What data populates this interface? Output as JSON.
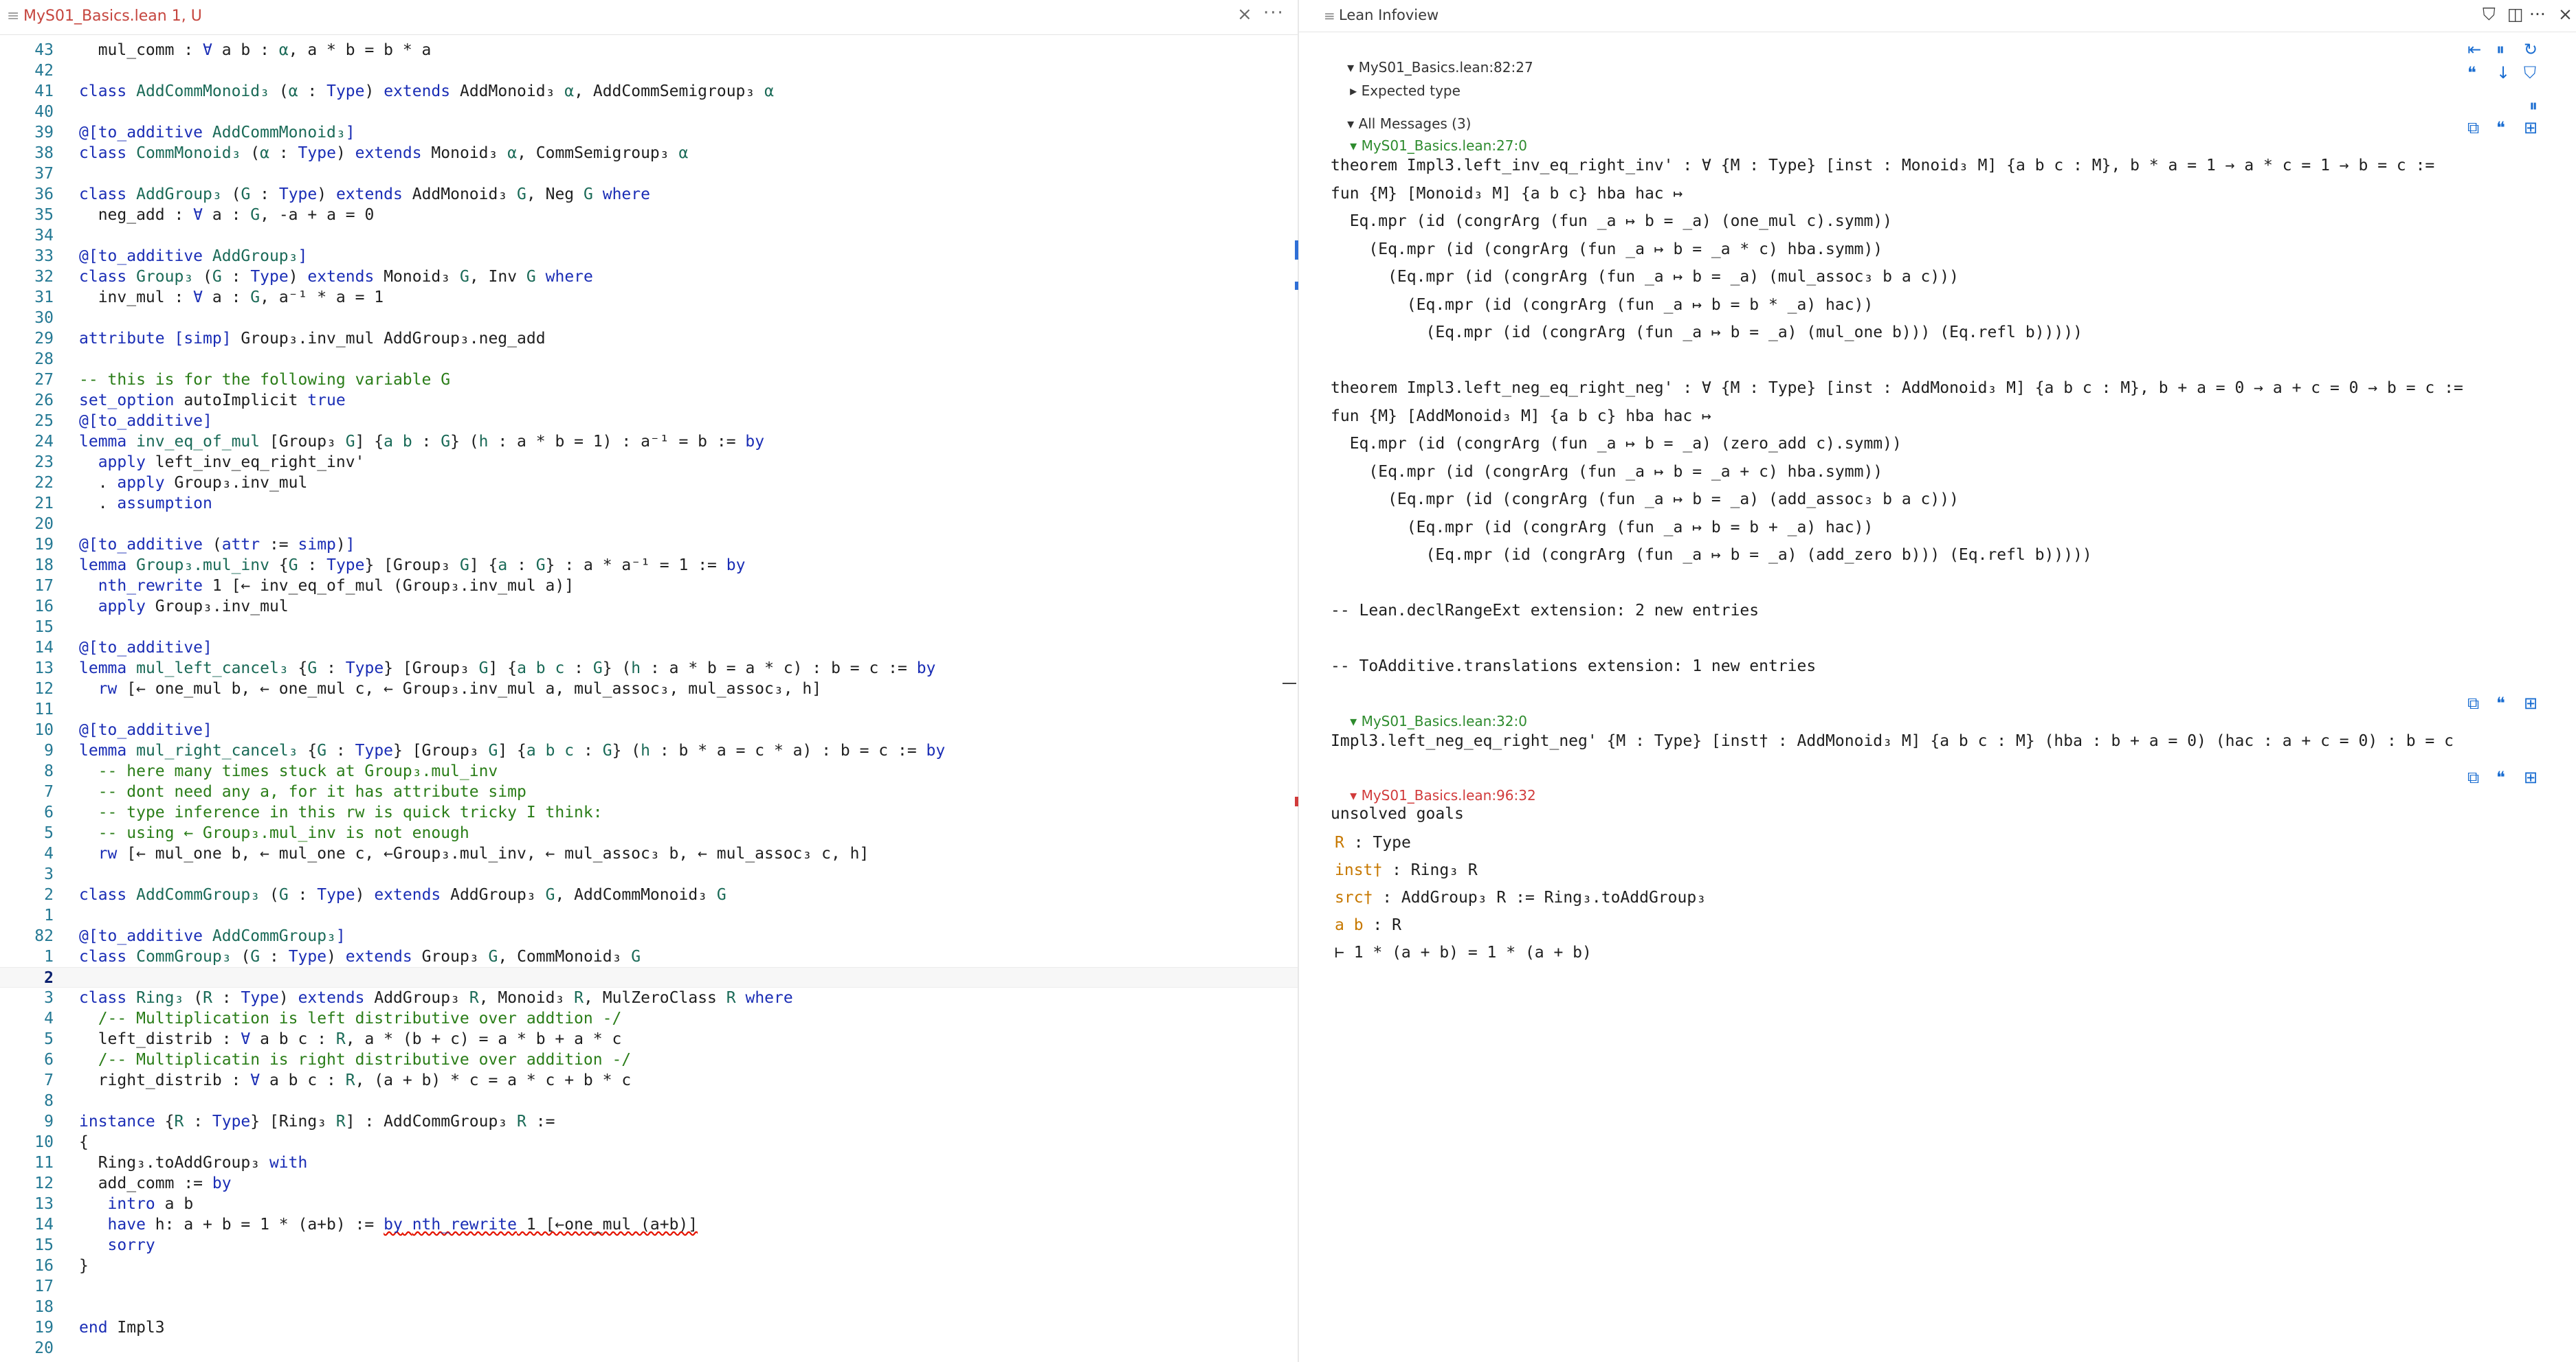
{
  "editor": {
    "tab_menu_icon": "hamburger-icon",
    "tab_title": "MyS01_Basics.lean 1, U",
    "close_glyph": "×",
    "more_glyph": "···",
    "lines": [
      {
        "n": "43",
        "html": "  mul_comm : <span class=\"k\">∀</span> a b : <span class=\"t\">α</span>, a * b = b * a"
      },
      {
        "n": "42",
        "html": ""
      },
      {
        "n": "41",
        "html": "<span class=\"k\">class</span> <span class=\"t\">AddCommMonoid₃</span> (<span class=\"t\">α</span> : <span class=\"k\">Type</span>) <span class=\"k\">extends</span> AddMonoid₃ <span class=\"t\">α</span>, AddCommSemigroup₃ <span class=\"t\">α</span>"
      },
      {
        "n": "40",
        "html": ""
      },
      {
        "n": "39",
        "html": "<span class=\"k\">@[to_additive</span> <span class=\"t\">AddCommMonoid₃</span><span class=\"k\">]</span>"
      },
      {
        "n": "38",
        "html": "<span class=\"k\">class</span> <span class=\"t\">CommMonoid₃</span> (<span class=\"t\">α</span> : <span class=\"k\">Type</span>) <span class=\"k\">extends</span> Monoid₃ <span class=\"t\">α</span>, CommSemigroup₃ <span class=\"t\">α</span>"
      },
      {
        "n": "37",
        "html": ""
      },
      {
        "n": "36",
        "html": "<span class=\"k\">class</span> <span class=\"t\">AddGroup₃</span> (<span class=\"t\">G</span> : <span class=\"k\">Type</span>) <span class=\"k\">extends</span> AddMonoid₃ <span class=\"t\">G</span>, Neg <span class=\"t\">G</span> <span class=\"k\">where</span>"
      },
      {
        "n": "35",
        "html": "  neg_add : <span class=\"k\">∀</span> a : <span class=\"t\">G</span>, -a + a = 0"
      },
      {
        "n": "34",
        "html": ""
      },
      {
        "n": "33",
        "html": "<span class=\"k\">@[to_additive</span> <span class=\"t\">AddGroup₃</span><span class=\"k\">]</span>"
      },
      {
        "n": "32",
        "html": "<span class=\"k\">class</span> <span class=\"t\">Group₃</span> (<span class=\"t\">G</span> : <span class=\"k\">Type</span>) <span class=\"k\">extends</span> Monoid₃ <span class=\"t\">G</span>, Inv <span class=\"t\">G</span> <span class=\"k\">where</span>"
      },
      {
        "n": "31",
        "html": "  inv_mul : <span class=\"k\">∀</span> a : <span class=\"t\">G</span>, a⁻¹ * a = 1"
      },
      {
        "n": "30",
        "html": ""
      },
      {
        "n": "29",
        "html": "<span class=\"k\">attribute</span> <span class=\"k\">[simp]</span> Group₃.inv_mul AddGroup₃.neg_add"
      },
      {
        "n": "28",
        "html": ""
      },
      {
        "n": "27",
        "html": "<span class=\"c\">-- this is for the following variable G</span>"
      },
      {
        "n": "26",
        "html": "<span class=\"k\">set_option</span> autoImplicit <span class=\"k\">true</span>"
      },
      {
        "n": "25",
        "html": "<span class=\"k\">@[to_additive]</span>"
      },
      {
        "n": "24",
        "html": "<span class=\"k\">lemma</span> <span class=\"t\">inv_eq_of_mul</span> [Group₃ <span class=\"t\">G</span>] {<span class=\"t\">a b</span> : <span class=\"t\">G</span>} (<span class=\"t\">h</span> : a * b = 1) : a⁻¹ = b := <span class=\"k\">by</span>"
      },
      {
        "n": "23",
        "html": "  <span class=\"k\">apply</span> left_inv_eq_right_inv'"
      },
      {
        "n": "22",
        "html": "  . <span class=\"k\">apply</span> Group₃.inv_mul"
      },
      {
        "n": "21",
        "html": "  . <span class=\"k\">assumption</span>"
      },
      {
        "n": "20",
        "html": ""
      },
      {
        "n": "19",
        "html": "<span class=\"k\">@[to_additive</span> (<span class=\"k\">attr</span> := <span class=\"k\">simp</span>)<span class=\"k\">]</span>"
      },
      {
        "n": "18",
        "html": "<span class=\"k\">lemma</span> <span class=\"t\">Group₃.mul_inv</span> {<span class=\"t\">G</span> : <span class=\"k\">Type</span>} [Group₃ <span class=\"t\">G</span>] {<span class=\"t\">a</span> : <span class=\"t\">G</span>} : a * a⁻¹ = 1 := <span class=\"k\">by</span>"
      },
      {
        "n": "17",
        "html": "  <span class=\"k\">nth_rewrite</span> 1 [← inv_eq_of_mul (Group₃.inv_mul a)]"
      },
      {
        "n": "16",
        "html": "  <span class=\"k\">apply</span> Group₃.inv_mul"
      },
      {
        "n": "15",
        "html": ""
      },
      {
        "n": "14",
        "html": "<span class=\"k\">@[to_additive]</span>"
      },
      {
        "n": "13",
        "html": "<span class=\"k\">lemma</span> <span class=\"t\">mul_left_cancel₃</span> {<span class=\"t\">G</span> : <span class=\"k\">Type</span>} [Group₃ <span class=\"t\">G</span>] {<span class=\"t\">a b c</span> : <span class=\"t\">G</span>} (<span class=\"t\">h</span> : a * b = a * c) : b = c := <span class=\"k\">by</span>"
      },
      {
        "n": "12",
        "html": "  <span class=\"k\">rw</span> [← one_mul b, ← one_mul c, ← Group₃.inv_mul a, mul_assoc₃, mul_assoc₃, h]"
      },
      {
        "n": "11",
        "html": ""
      },
      {
        "n": "10",
        "html": "<span class=\"k\">@[to_additive]</span>"
      },
      {
        "n": "9",
        "html": "<span class=\"k\">lemma</span> <span class=\"t\">mul_right_cancel₃</span> {<span class=\"t\">G</span> : <span class=\"k\">Type</span>} [Group₃ <span class=\"t\">G</span>] {<span class=\"t\">a b c</span> : <span class=\"t\">G</span>} (<span class=\"t\">h</span> : b * a = c * a) : b = c := <span class=\"k\">by</span>"
      },
      {
        "n": "8",
        "html": "  <span class=\"c\">-- here many times stuck at Group₃.mul_inv</span>"
      },
      {
        "n": "7",
        "html": "  <span class=\"c\">-- dont need any a, for it has attribute simp</span>"
      },
      {
        "n": "6",
        "html": "  <span class=\"c\">-- type inference in this rw is quick tricky I think:</span>"
      },
      {
        "n": "5",
        "html": "  <span class=\"c\">-- using ← Group₃.mul_inv is not enough</span>"
      },
      {
        "n": "4",
        "html": "  <span class=\"k\">rw</span> [← mul_one b, ← mul_one c, ←Group₃.mul_inv, ← mul_assoc₃ b, ← mul_assoc₃ c, h]"
      },
      {
        "n": "3",
        "html": ""
      },
      {
        "n": "2",
        "html": "<span class=\"k\">class</span> <span class=\"t\">AddCommGroup₃</span> (<span class=\"t\">G</span> : <span class=\"k\">Type</span>) <span class=\"k\">extends</span> AddGroup₃ <span class=\"t\">G</span>, AddCommMonoid₃ <span class=\"t\">G</span>"
      },
      {
        "n": "1",
        "html": ""
      },
      {
        "n": "82",
        "html": "<span class=\"k\">@[to_additive</span> <span class=\"t\">AddCommGroup₃</span><span class=\"k\">]</span>"
      },
      {
        "n": "1",
        "html": "<span class=\"k\">class</span> <span class=\"t\">CommGroup₃</span> (<span class=\"t\">G</span> : <span class=\"k\">Type</span>) <span class=\"k\">extends</span> Group₃ <span class=\"t\">G</span>, CommMonoid₃ <span class=\"t\">G</span>"
      },
      {
        "n": "2",
        "html": ""
      },
      {
        "n": "3",
        "html": "<span class=\"k\">class</span> <span class=\"t\">Ring₃</span> (<span class=\"t\">R</span> : <span class=\"k\">Type</span>) <span class=\"k\">extends</span> AddGroup₃ <span class=\"t\">R</span>, Monoid₃ <span class=\"t\">R</span>, MulZeroClass <span class=\"t\">R</span> <span class=\"k\">where</span>"
      },
      {
        "n": "4",
        "html": "  <span class=\"c\">/-- Multiplication is left distributive over addtion -/</span>"
      },
      {
        "n": "5",
        "html": "  left_distrib : <span class=\"k\">∀</span> a b c : <span class=\"t\">R</span>, a * (b + c) = a * b + a * c"
      },
      {
        "n": "6",
        "html": "  <span class=\"c\">/-- Multiplicatin is right distributive over addition -/</span>"
      },
      {
        "n": "7",
        "html": "  right_distrib : <span class=\"k\">∀</span> a b c : <span class=\"t\">R</span>, (a + b) * c = a * c + b * c"
      },
      {
        "n": "8",
        "html": ""
      },
      {
        "n": "9",
        "html": "<span class=\"k\">instance</span> {<span class=\"t\">R</span> : <span class=\"k\">Type</span>} [Ring₃ <span class=\"t\">R</span>] : AddCommGroup₃ <span class=\"t\">R</span> :="
      },
      {
        "n": "10",
        "html": "{"
      },
      {
        "n": "11",
        "html": "  Ring₃.toAddGroup₃ <span class=\"k\">with</span>"
      },
      {
        "n": "12",
        "html": "  add_comm := <span class=\"k\">by</span>"
      },
      {
        "n": "13",
        "html": "   <span class=\"k\">intro</span> a b"
      },
      {
        "n": "14",
        "html": "   <span class=\"k\">have</span> h: a + b = 1 * (a+b) := <span class=\"err\"><span class=\"k\">by</span> <span class=\"k\">nth_rewrite</span> 1 [←one_mul (a+b)]</span>"
      },
      {
        "n": "15",
        "html": "   <span class=\"k\">sorry</span>"
      },
      {
        "n": "16",
        "html": "}"
      },
      {
        "n": "17",
        "html": ""
      },
      {
        "n": "18",
        "html": ""
      },
      {
        "n": "19",
        "html": "<span class=\"k\">end</span> Impl3"
      },
      {
        "n": "20",
        "html": ""
      }
    ]
  },
  "infoview": {
    "menu_icon": "hamburger-icon",
    "title": "Lean Infoview",
    "header_icons": [
      "filter-icon",
      "split-icon",
      "more-icon",
      "close-icon"
    ],
    "header_glyphs": [
      "⛉",
      "◫",
      "···",
      "×"
    ],
    "cursor_location": "MyS01_Basics.lean:82:27",
    "expected_type_label": "Expected type",
    "all_messages_label": "All Messages (3)",
    "toolbar_glyphs": [
      "⇤",
      "⏸",
      "↻",
      "❝",
      "↓",
      "⛉"
    ],
    "msg1": {
      "location": "MyS01_Basics.lean:27:0",
      "lines": [
        "theorem Impl3.left_inv_eq_right_inv' : ∀ {M : Type} [inst : Monoid₃ M] {a b c : M}, b * a = 1 → a * c = 1 → b = c :=",
        "fun {M} [Monoid₃ M] {a b c} hba hac ↦",
        "  Eq.mpr (id (congrArg (fun _a ↦ b = _a) (one_mul c).symm))",
        "    (Eq.mpr (id (congrArg (fun _a ↦ b = _a * c) hba.symm))",
        "      (Eq.mpr (id (congrArg (fun _a ↦ b = _a) (mul_assoc₃ b a c)))",
        "        (Eq.mpr (id (congrArg (fun _a ↦ b = b * _a) hac))",
        "          (Eq.mpr (id (congrArg (fun _a ↦ b = _a) (mul_one b))) (Eq.refl b)))))",
        "",
        "theorem Impl3.left_neg_eq_right_neg' : ∀ {M : Type} [inst : AddMonoid₃ M] {a b c : M}, b + a = 0 → a + c = 0 → b = c :=",
        "fun {M} [AddMonoid₃ M] {a b c} hba hac ↦",
        "  Eq.mpr (id (congrArg (fun _a ↦ b = _a) (zero_add c).symm))",
        "    (Eq.mpr (id (congrArg (fun _a ↦ b = _a + c) hba.symm))",
        "      (Eq.mpr (id (congrArg (fun _a ↦ b = _a) (add_assoc₃ b a c)))",
        "        (Eq.mpr (id (congrArg (fun _a ↦ b = b + _a) hac))",
        "          (Eq.mpr (id (congrArg (fun _a ↦ b = _a) (add_zero b))) (Eq.refl b)))))",
        "",
        "-- Lean.declRangeExt extension: 2 new entries",
        "",
        "-- ToAdditive.translations extension: 1 new entries"
      ]
    },
    "msg2": {
      "location": "MyS01_Basics.lean:32:0",
      "text": "Impl3.left_neg_eq_right_neg' {M : Type} [inst† : AddMonoid₃ M] {a b c : M} (hba : b + a = 0) (hac : a + c = 0) : b = c"
    },
    "msg3": {
      "location": "MyS01_Basics.lean:96:32",
      "title": "unsolved goals",
      "goals": [
        {
          "name": "R",
          "rest": " : Type"
        },
        {
          "name": "inst†",
          "rest": " : Ring₃ R"
        },
        {
          "name": "src†",
          "rest": " : AddGroup₃ R := Ring₃.toAddGroup₃"
        },
        {
          "name": "a b",
          "rest": " : R"
        }
      ],
      "turnstile": "⊢ 1 * (a + b) = 1 * (a + b)"
    },
    "msg_icons": [
      "copy-icon",
      "quote-icon",
      "pin-icon"
    ],
    "msg_glyphs": [
      "⧉",
      "❝",
      "⊞"
    ]
  }
}
